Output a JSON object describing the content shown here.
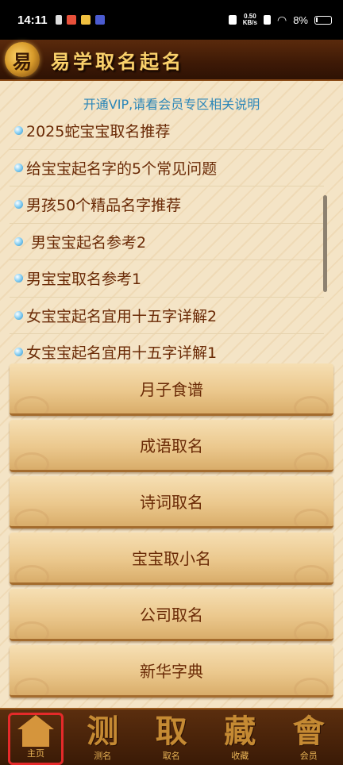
{
  "status_bar": {
    "time": "14:11",
    "net_speed_value": "0.50",
    "net_speed_unit": "KB/s",
    "battery": "8%"
  },
  "header": {
    "logo_glyph": "易",
    "title": "易学取名起名"
  },
  "vip_notice": "开通VIP,请看会员专区相关说明",
  "news": [
    "2025蛇宝宝取名推荐",
    "给宝宝起名字的5个常见问题",
    "男孩50个精品名字推荐",
    " 男宝宝起名参考2",
    "男宝宝取名参考1",
    "女宝宝起名宜用十五字详解2",
    "女宝宝起名宜用十五字详解1"
  ],
  "menu": [
    "月子食谱",
    "成语取名",
    "诗词取名",
    "宝宝取小名",
    "公司取名",
    "新华字典"
  ],
  "bottom_nav": [
    {
      "glyph": "",
      "label": "主页",
      "icon": "home-icon"
    },
    {
      "glyph": "测",
      "label": "测名"
    },
    {
      "glyph": "取",
      "label": "取名"
    },
    {
      "glyph": "藏",
      "label": "收藏"
    },
    {
      "glyph": "會",
      "label": "会员"
    }
  ],
  "colors": {
    "accent_text": "#6a2a06",
    "vip_text": "#2b86b8",
    "header_bg": "#3d1906",
    "highlight_border": "#e52a2a"
  }
}
